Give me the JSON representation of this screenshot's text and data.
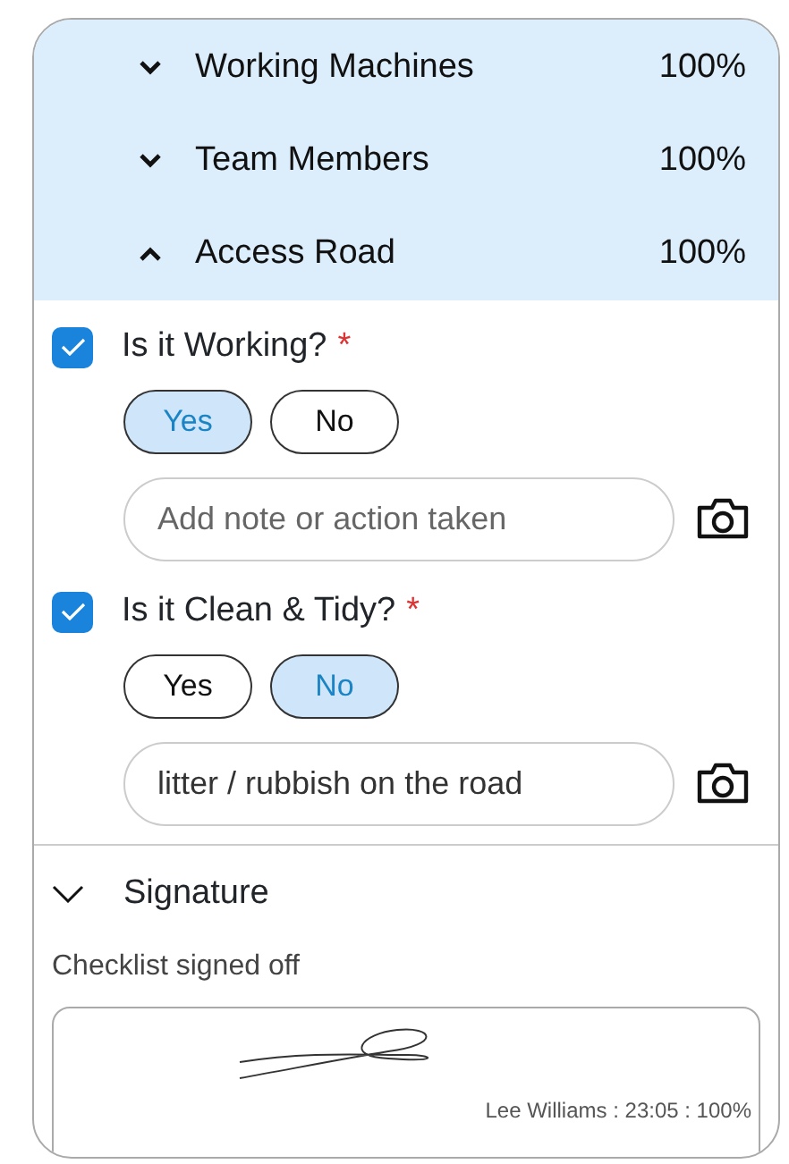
{
  "sections": [
    {
      "title": "Working Machines",
      "percent": "100%",
      "expanded": false
    },
    {
      "title": "Team Members",
      "percent": "100%",
      "expanded": false
    },
    {
      "title": "Access Road",
      "percent": "100%",
      "expanded": true
    }
  ],
  "questions": [
    {
      "label": "Is it Working?",
      "required": "*",
      "checked": true,
      "options": [
        {
          "label": "Yes",
          "selected": true
        },
        {
          "label": "No",
          "selected": false
        }
      ],
      "note": {
        "placeholder": "Add note or action taken"
      }
    },
    {
      "label": "Is it Clean & Tidy?",
      "required": "*",
      "checked": true,
      "options": [
        {
          "label": "Yes",
          "selected": false
        },
        {
          "label": "No",
          "selected": true
        }
      ],
      "note": {
        "value": "litter / rubbish on the road"
      }
    }
  ],
  "signature": {
    "title": "Signature",
    "caption": "Checklist signed off",
    "signed_by": "Lee Williams : 23:05 : 100%"
  }
}
